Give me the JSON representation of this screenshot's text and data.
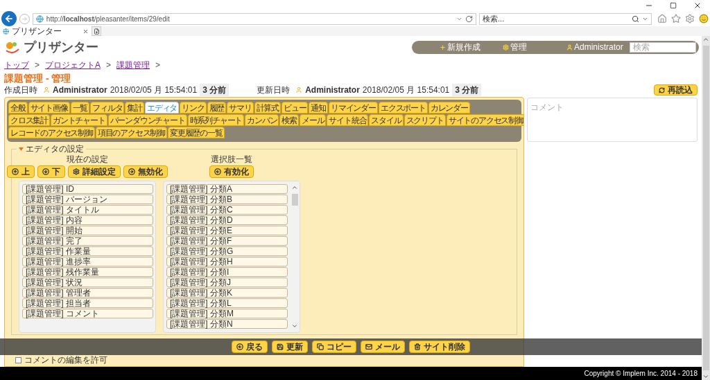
{
  "browser": {
    "url": "http://**localhost**/pleasanter/items/29/edit",
    "search_placeholder": "検索...",
    "tab_title": "プリザンター"
  },
  "header": {
    "app_name": "プリザンター",
    "nav": [
      "新規作成",
      "管理",
      "Administrator"
    ],
    "search_placeholder": "検索"
  },
  "breadcrumb": [
    {
      "label": "トップ",
      "separator": ">"
    },
    {
      "label": "プロジェクトA",
      "separator": ">"
    },
    {
      "label": "課題管理",
      "separator": ">"
    }
  ],
  "title": "課題管理 - 管理",
  "created": {
    "label": "作成日時",
    "user": "Administrator",
    "datetime": "2018/02/05 月 15:54:01",
    "ago": "3 分前"
  },
  "updated": {
    "label": "更新日時",
    "user": "Administrator",
    "datetime": "2018/02/05 月 15:54:01",
    "ago": "3 分前"
  },
  "reload_button": "再読込",
  "tab_rows": [
    [
      {
        "label": "全般",
        "selected": false
      },
      {
        "label": "サイト画像",
        "selected": false
      },
      {
        "label": "一覧",
        "selected": false
      },
      {
        "label": "フィルタ",
        "selected": false
      },
      {
        "label": "集計",
        "selected": false
      },
      {
        "label": "エディタ",
        "selected": true
      },
      {
        "label": "リンク",
        "selected": false
      },
      {
        "label": "履歴",
        "selected": false
      },
      {
        "label": "サマリ",
        "selected": false
      },
      {
        "label": "計算式",
        "selected": false
      },
      {
        "label": "ビュー",
        "selected": false
      },
      {
        "label": "通知",
        "selected": false
      },
      {
        "label": "リマインダー",
        "selected": false
      },
      {
        "label": "エクスポート",
        "selected": false
      },
      {
        "label": "カレンダー",
        "selected": false
      }
    ],
    [
      {
        "label": "クロス集計",
        "selected": false
      },
      {
        "label": "ガントチャート",
        "selected": false
      },
      {
        "label": "バーンダウンチャート",
        "selected": false
      },
      {
        "label": "時系列チャート",
        "selected": false
      },
      {
        "label": "カンバン",
        "selected": false
      },
      {
        "label": "検索",
        "selected": false
      },
      {
        "label": "メール",
        "selected": false
      },
      {
        "label": "サイト統合",
        "selected": false
      },
      {
        "label": "スタイル",
        "selected": false
      },
      {
        "label": "スクリプト",
        "selected": false
      },
      {
        "label": "サイトのアクセス制御",
        "selected": false
      }
    ],
    [
      {
        "label": "レコードのアクセス制御",
        "selected": false
      },
      {
        "label": "項目のアクセス制御",
        "selected": false
      },
      {
        "label": "変更履歴の一覧",
        "selected": false
      }
    ]
  ],
  "editor": {
    "legend": "エディタの設定",
    "expanded": true,
    "current": {
      "heading": "現在の設定",
      "buttons": [
        "上",
        "下",
        "詳細設定",
        "無効化"
      ],
      "items": [
        "[課題管理] ID",
        "[課題管理] バージョン",
        "[課題管理] タイトル",
        "[課題管理] 内容",
        "[課題管理] 開始",
        "[課題管理] 完了",
        "[課題管理] 作業量",
        "[課題管理] 進捗率",
        "[課題管理] 残作業量",
        "[課題管理] 状況",
        "[課題管理] 管理者",
        "[課題管理] 担当者",
        "[課題管理] コメント"
      ]
    },
    "options": {
      "heading": "選択肢一覧",
      "buttons": [
        "有効化"
      ],
      "items": [
        "[課題管理] 分類A",
        "[課題管理] 分類B",
        "[課題管理] 分類C",
        "[課題管理] 分類D",
        "[課題管理] 分類E",
        "[課題管理] 分類F",
        "[課題管理] 分類G",
        "[課題管理] 分類H",
        "[課題管理] 分類I",
        "[課題管理] 分類J",
        "[課題管理] 分類K",
        "[課題管理] 分類L",
        "[課題管理] 分類M",
        "[課題管理] 分類N"
      ]
    }
  },
  "allow_comment_edit": {
    "label": "コメントの編集を許可",
    "checked": false
  },
  "comment": {
    "placeholder": "コメント"
  },
  "commands": [
    "戻る",
    "更新",
    "コピー",
    "メール",
    "サイト削除"
  ],
  "footer": "Copyright © Implem Inc. 2014 - 2018"
}
